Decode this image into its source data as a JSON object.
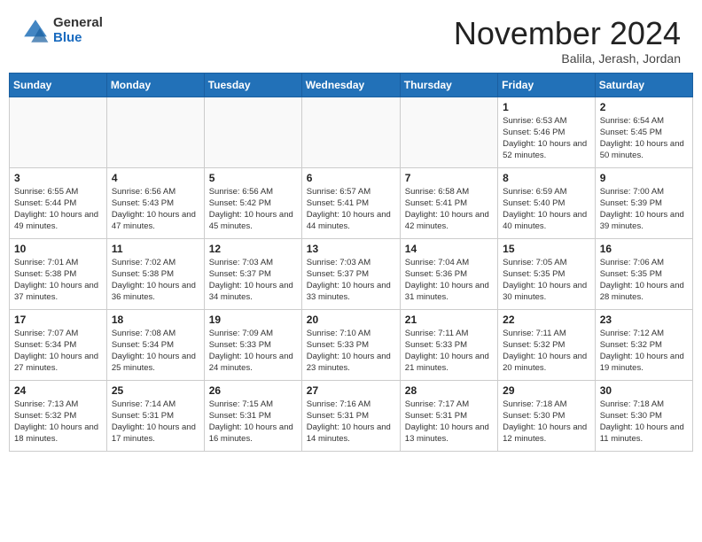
{
  "header": {
    "logo_general": "General",
    "logo_blue": "Blue",
    "month_title": "November 2024",
    "location": "Balila, Jerash, Jordan"
  },
  "calendar": {
    "days_of_week": [
      "Sunday",
      "Monday",
      "Tuesday",
      "Wednesday",
      "Thursday",
      "Friday",
      "Saturday"
    ],
    "weeks": [
      [
        {
          "day": "",
          "info": ""
        },
        {
          "day": "",
          "info": ""
        },
        {
          "day": "",
          "info": ""
        },
        {
          "day": "",
          "info": ""
        },
        {
          "day": "",
          "info": ""
        },
        {
          "day": "1",
          "info": "Sunrise: 6:53 AM\nSunset: 5:46 PM\nDaylight: 10 hours and 52 minutes."
        },
        {
          "day": "2",
          "info": "Sunrise: 6:54 AM\nSunset: 5:45 PM\nDaylight: 10 hours and 50 minutes."
        }
      ],
      [
        {
          "day": "3",
          "info": "Sunrise: 6:55 AM\nSunset: 5:44 PM\nDaylight: 10 hours and 49 minutes."
        },
        {
          "day": "4",
          "info": "Sunrise: 6:56 AM\nSunset: 5:43 PM\nDaylight: 10 hours and 47 minutes."
        },
        {
          "day": "5",
          "info": "Sunrise: 6:56 AM\nSunset: 5:42 PM\nDaylight: 10 hours and 45 minutes."
        },
        {
          "day": "6",
          "info": "Sunrise: 6:57 AM\nSunset: 5:41 PM\nDaylight: 10 hours and 44 minutes."
        },
        {
          "day": "7",
          "info": "Sunrise: 6:58 AM\nSunset: 5:41 PM\nDaylight: 10 hours and 42 minutes."
        },
        {
          "day": "8",
          "info": "Sunrise: 6:59 AM\nSunset: 5:40 PM\nDaylight: 10 hours and 40 minutes."
        },
        {
          "day": "9",
          "info": "Sunrise: 7:00 AM\nSunset: 5:39 PM\nDaylight: 10 hours and 39 minutes."
        }
      ],
      [
        {
          "day": "10",
          "info": "Sunrise: 7:01 AM\nSunset: 5:38 PM\nDaylight: 10 hours and 37 minutes."
        },
        {
          "day": "11",
          "info": "Sunrise: 7:02 AM\nSunset: 5:38 PM\nDaylight: 10 hours and 36 minutes."
        },
        {
          "day": "12",
          "info": "Sunrise: 7:03 AM\nSunset: 5:37 PM\nDaylight: 10 hours and 34 minutes."
        },
        {
          "day": "13",
          "info": "Sunrise: 7:03 AM\nSunset: 5:37 PM\nDaylight: 10 hours and 33 minutes."
        },
        {
          "day": "14",
          "info": "Sunrise: 7:04 AM\nSunset: 5:36 PM\nDaylight: 10 hours and 31 minutes."
        },
        {
          "day": "15",
          "info": "Sunrise: 7:05 AM\nSunset: 5:35 PM\nDaylight: 10 hours and 30 minutes."
        },
        {
          "day": "16",
          "info": "Sunrise: 7:06 AM\nSunset: 5:35 PM\nDaylight: 10 hours and 28 minutes."
        }
      ],
      [
        {
          "day": "17",
          "info": "Sunrise: 7:07 AM\nSunset: 5:34 PM\nDaylight: 10 hours and 27 minutes."
        },
        {
          "day": "18",
          "info": "Sunrise: 7:08 AM\nSunset: 5:34 PM\nDaylight: 10 hours and 25 minutes."
        },
        {
          "day": "19",
          "info": "Sunrise: 7:09 AM\nSunset: 5:33 PM\nDaylight: 10 hours and 24 minutes."
        },
        {
          "day": "20",
          "info": "Sunrise: 7:10 AM\nSunset: 5:33 PM\nDaylight: 10 hours and 23 minutes."
        },
        {
          "day": "21",
          "info": "Sunrise: 7:11 AM\nSunset: 5:33 PM\nDaylight: 10 hours and 21 minutes."
        },
        {
          "day": "22",
          "info": "Sunrise: 7:11 AM\nSunset: 5:32 PM\nDaylight: 10 hours and 20 minutes."
        },
        {
          "day": "23",
          "info": "Sunrise: 7:12 AM\nSunset: 5:32 PM\nDaylight: 10 hours and 19 minutes."
        }
      ],
      [
        {
          "day": "24",
          "info": "Sunrise: 7:13 AM\nSunset: 5:32 PM\nDaylight: 10 hours and 18 minutes."
        },
        {
          "day": "25",
          "info": "Sunrise: 7:14 AM\nSunset: 5:31 PM\nDaylight: 10 hours and 17 minutes."
        },
        {
          "day": "26",
          "info": "Sunrise: 7:15 AM\nSunset: 5:31 PM\nDaylight: 10 hours and 16 minutes."
        },
        {
          "day": "27",
          "info": "Sunrise: 7:16 AM\nSunset: 5:31 PM\nDaylight: 10 hours and 14 minutes."
        },
        {
          "day": "28",
          "info": "Sunrise: 7:17 AM\nSunset: 5:31 PM\nDaylight: 10 hours and 13 minutes."
        },
        {
          "day": "29",
          "info": "Sunrise: 7:18 AM\nSunset: 5:30 PM\nDaylight: 10 hours and 12 minutes."
        },
        {
          "day": "30",
          "info": "Sunrise: 7:18 AM\nSunset: 5:30 PM\nDaylight: 10 hours and 11 minutes."
        }
      ]
    ]
  }
}
